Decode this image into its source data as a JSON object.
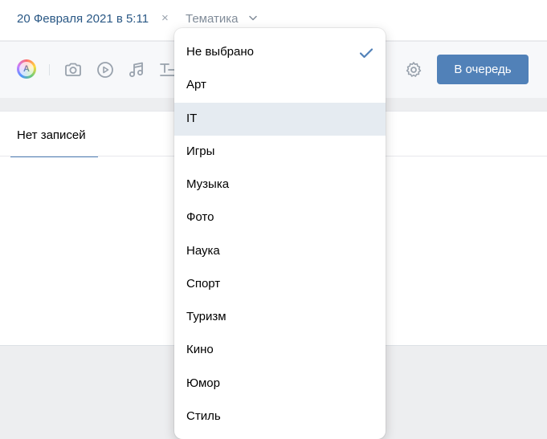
{
  "header": {
    "date_label": "20 Февраля 2021 в 5:11",
    "date_clear_symbol": "×",
    "topic_label": "Тематика"
  },
  "toolbar": {
    "avatar_letter": "A",
    "queue_button_label": "В очередь"
  },
  "tabs": {
    "active_label": "Нет записей"
  },
  "topic_menu": {
    "selected": "Не выбрано",
    "highlighted": "IT",
    "items": [
      "Не выбрано",
      "Арт",
      "IT",
      "Игры",
      "Музыка",
      "Фото",
      "Наука",
      "Спорт",
      "Туризм",
      "Кино",
      "Юмор",
      "Стиль"
    ]
  },
  "colors": {
    "accent": "#5181b8",
    "link": "#2a5885",
    "muted": "#818c99",
    "icon": "#99a2ad",
    "hover_row": "#e5ebf1"
  }
}
